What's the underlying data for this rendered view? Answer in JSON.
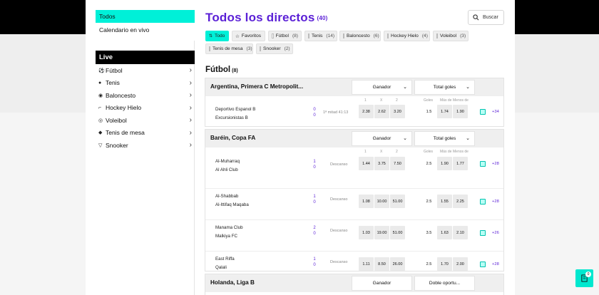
{
  "sidebar": {
    "top_items": [
      {
        "label": "Todos"
      },
      {
        "label": "Calendario en vivo"
      }
    ],
    "live_heading": "Live",
    "sports": [
      {
        "label": "Fútbol",
        "icon": "soccer-icon"
      },
      {
        "label": "Tenis",
        "icon": "tennis-icon"
      },
      {
        "label": "Baloncesto",
        "icon": "basketball-icon"
      },
      {
        "label": "Hockey Hielo",
        "icon": "hockey-icon"
      },
      {
        "label": "Voleibol",
        "icon": "volleyball-icon"
      },
      {
        "label": "Tenis de mesa",
        "icon": "table-tennis-icon"
      },
      {
        "label": "Snooker",
        "icon": "snooker-icon"
      }
    ]
  },
  "header": {
    "title": "Todos los directos",
    "count": "(40)",
    "search_label": "Buscar"
  },
  "filters": [
    {
      "label": "Todo",
      "count": ""
    },
    {
      "label": "Favoritos",
      "count": ""
    },
    {
      "label": "Fútbol",
      "count": "(8)"
    },
    {
      "label": "Tenis",
      "count": "(14)"
    },
    {
      "label": "Baloncesto",
      "count": "(6)"
    },
    {
      "label": "Hockey Hielo",
      "count": "(4)"
    },
    {
      "label": "Voleibol",
      "count": "(3)"
    },
    {
      "label": "Tenis de mesa",
      "count": "(3)"
    },
    {
      "label": "Snooker",
      "count": "(2)"
    }
  ],
  "section": {
    "title": "Fútbol",
    "count": "(8)"
  },
  "leagues": [
    {
      "name": "Argentina, Primera C Metropolit...",
      "market1": "Ganador",
      "market2": "Total goles",
      "labels1": [
        "1",
        "X",
        "2"
      ],
      "labels2": [
        "Goles",
        "Más de",
        "Menos de"
      ],
      "matches": [
        {
          "home": "Deportivo Espanol B",
          "away": "Excursionistas B",
          "score_home": "0",
          "score_away": "0",
          "status": "1ª mitad 41:13",
          "odds1": [
            "2.38",
            "2.62",
            "3.20"
          ],
          "line": "1.5",
          "over": "1.74",
          "under": "1.90",
          "more": "+34"
        }
      ]
    },
    {
      "name": "Baréin, Copa FA",
      "market1": "Ganador",
      "market2": "Total goles",
      "labels1": [
        "1",
        "X",
        "2"
      ],
      "labels2": [
        "Goles",
        "Más de",
        "Menos de"
      ],
      "matches": [
        {
          "home": "Al-Muharraq",
          "away": "Al Ahli Club",
          "score_home": "1",
          "score_away": "0",
          "status": "Descanso",
          "odds1": [
            "1.44",
            "3.75",
            "7.50"
          ],
          "line": "2.5",
          "over": "1.90",
          "under": "1.77",
          "more": "+28"
        },
        {
          "home": "Al-Shabbab",
          "away": "Al-Ittifaq Maqaba",
          "score_home": "1",
          "score_away": "0",
          "status": "Descanso",
          "odds1": [
            "1.08",
            "10.00",
            "51.00"
          ],
          "line": "2.5",
          "over": "1.55",
          "under": "2.25",
          "more": "+28"
        },
        {
          "home": "Manama Club",
          "away": "Malkiya FC",
          "score_home": "2",
          "score_away": "0",
          "status": "Descanso",
          "odds1": [
            "1.03",
            "19.00",
            "51.00"
          ],
          "line": "3.5",
          "over": "1.63",
          "under": "2.10",
          "more": "+26"
        },
        {
          "home": "East Riffa",
          "away": "Qalali",
          "score_home": "1",
          "score_away": "0",
          "status": "Descanso",
          "odds1": [
            "1.11",
            "8.50",
            "26.00"
          ],
          "line": "2.5",
          "over": "1.70",
          "under": "2.00",
          "more": "+28"
        }
      ]
    },
    {
      "name": "Holanda, Liga B",
      "market1": "Ganador",
      "market2": "Doble oportu...",
      "matches": []
    }
  ],
  "betslip": {
    "count": "0"
  },
  "colors": {
    "accent": "#00f0d8",
    "brand": "#5a1fd6"
  }
}
